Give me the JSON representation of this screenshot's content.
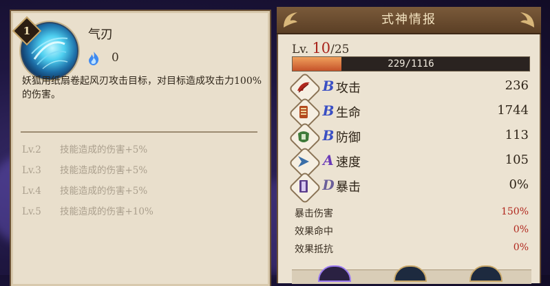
{
  "skill": {
    "number": "1",
    "name": "气刃",
    "cost": "0",
    "description": "妖狐用纸扇卷起风刃攻击目标，对目标造成攻击力100%的伤害。",
    "upgrades": [
      {
        "level": "Lv.2",
        "effect": "技能造成的伤害+5%"
      },
      {
        "level": "Lv.3",
        "effect": "技能造成的伤害+5%"
      },
      {
        "level": "Lv.4",
        "effect": "技能造成的伤害+5%"
      },
      {
        "level": "Lv.5",
        "effect": "技能造成的伤害+10%"
      }
    ],
    "icon": "wind-blade-skill-icon"
  },
  "info": {
    "title": "式神情报",
    "level_prefix": "Lv.",
    "level_current": "10",
    "level_max": "/25",
    "xp_text": "229/1116",
    "xp_fraction": 0.205,
    "stats": [
      {
        "grade": "B",
        "label": "攻击",
        "value": "236",
        "icon": "attack-icon",
        "grade_color": "#3a4fc4"
      },
      {
        "grade": "B",
        "label": "生命",
        "value": "1744",
        "icon": "health-icon",
        "grade_color": "#3a4fc4"
      },
      {
        "grade": "B",
        "label": "防御",
        "value": "113",
        "icon": "defense-icon",
        "grade_color": "#3a4fc4"
      },
      {
        "grade": "A",
        "label": "速度",
        "value": "105",
        "icon": "speed-icon",
        "grade_color": "#6a3ab8"
      },
      {
        "grade": "D",
        "label": "暴击",
        "value": "0%",
        "icon": "crit-icon",
        "grade_color": "#6b5f9a"
      }
    ],
    "sub_stats": [
      {
        "label": "暴击伤害",
        "value": "150%"
      },
      {
        "label": "效果命中",
        "value": "0%"
      },
      {
        "label": "效果抵抗",
        "value": "0%"
      }
    ]
  },
  "colors": {
    "panel": "#ece3d2",
    "accent_red": "#b0261c",
    "header_brown": "#6b4a2c"
  }
}
